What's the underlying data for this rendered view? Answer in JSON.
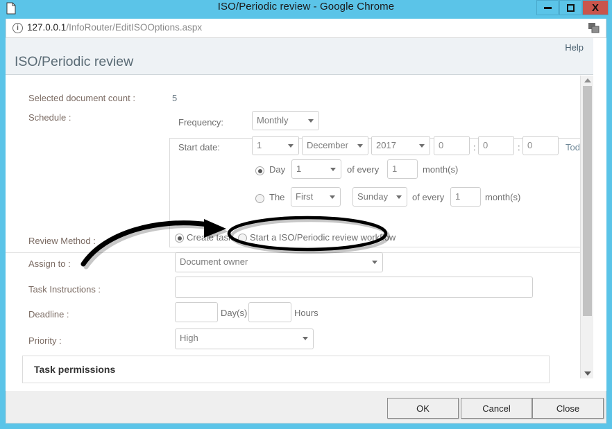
{
  "titlebar": {
    "title": "ISO/Periodic review - Google Chrome",
    "doc_icon": "document-icon",
    "minimize": "minimize-icon",
    "maximize": "maximize-icon",
    "close": "close-icon",
    "close_color": "#c9554c",
    "bar_color": "#5bc4e8"
  },
  "address": {
    "host": "127.0.0.1",
    "path": "/InfoRouter/EditISOOptions.aspx",
    "info_icon": "info-circle-icon",
    "right_icon": "page-translate-icon"
  },
  "page": {
    "help_label": "Help",
    "title": "ISO/Periodic review"
  },
  "form": {
    "doc_count_label": "Selected document count :",
    "doc_count_value": "5",
    "schedule_label": "Schedule :",
    "frequency_label": "Frequency:",
    "frequency_value": "Monthly",
    "start_date_label": "Start date:",
    "start_day": "1",
    "start_month": "December",
    "start_year": "2017",
    "start_hour": "0",
    "start_minute": "0",
    "start_second": "0",
    "colon1": ":",
    "colon2": ":",
    "today_label": "Today",
    "day_radio_label": "Day",
    "day_value": "1",
    "day_of_every_label": "of every",
    "day_every_value": "1",
    "day_months_label": "month(s)",
    "the_radio_label": "The",
    "the_ordinal": "First",
    "the_weekday": "Sunday",
    "the_of_every_label": "of every",
    "the_every_value": "1",
    "the_months_label": "month(s)",
    "review_method_label": "Review Method :",
    "review_option_1": "Create task",
    "review_option_2": "Start a ISO/Periodic review workflow",
    "assign_to_label": "Assign to :",
    "assign_to_value": "Document owner",
    "task_instructions_label": "Task Instructions :",
    "task_instructions_value": "",
    "deadline_label": "Deadline :",
    "deadline_days_value": "",
    "deadline_days_unit": "Day(s)",
    "deadline_hours_value": "",
    "deadline_hours_unit": "Hours",
    "priority_label": "Priority :",
    "priority_value": "High",
    "task_permissions_title": "Task permissions"
  },
  "footer": {
    "ok_label": "OK",
    "cancel_label": "Cancel",
    "close_label": "Close"
  },
  "annotation": {
    "ellipse": "highlight-ellipse",
    "arrow": "pointer-arrow",
    "color": "#000000"
  }
}
